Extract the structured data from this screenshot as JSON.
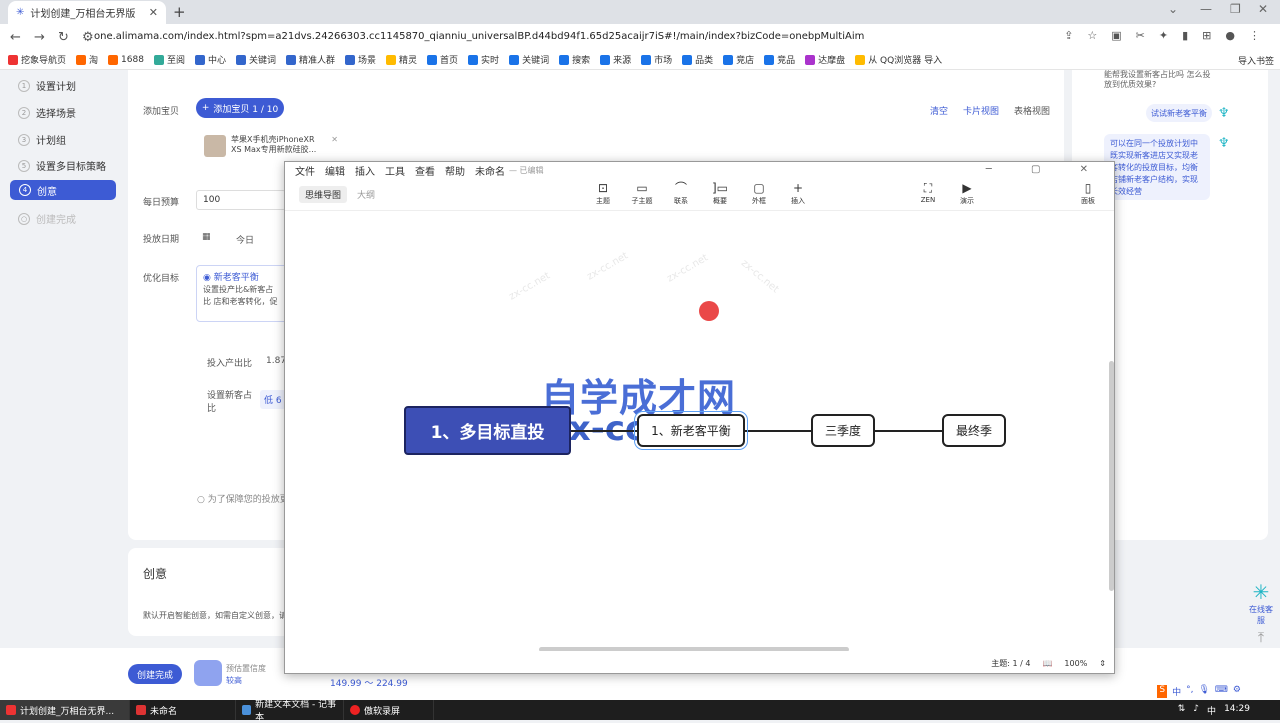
{
  "browser": {
    "tab_title": "计划创建_万相台无界版",
    "url": "one.alimama.com/index.html?spm=a21dvs.24266303.cc1145870_qianniu_universalBP.d44bd94f1.65d25acaijr7iS#!/main/index?bizCode=onebpMultiAim",
    "bookmarks": [
      "挖象导航页",
      "淘",
      "1688",
      "至阅",
      "中心",
      "关键词",
      "精准人群",
      "场景",
      "精灵",
      "首页",
      "实时",
      "关键词",
      "搜索",
      "来源",
      "市场",
      "品类",
      "竞店",
      "竞品",
      "达摩盘",
      "从 QQ浏览器 导入"
    ],
    "bookmarks_right": "导入书签"
  },
  "sidebar": {
    "steps": [
      {
        "n": "1",
        "label": "设置计划"
      },
      {
        "n": "2",
        "label": "选择场景"
      },
      {
        "n": "3",
        "label": "计划组"
      },
      {
        "n": "5",
        "label": "设置多目标策略"
      }
    ],
    "active": {
      "n": "4",
      "label": "创意"
    },
    "disabled": "创建完成"
  },
  "form": {
    "add_label": "添加宝贝",
    "add_btn": "添加宝贝 1 / 10",
    "clear": "清空",
    "card_view": "卡片视图",
    "table_view": "表格视图",
    "product": "苹果X手机壳iPhoneXR XS Max专用新款硅胶...",
    "budget_label": "每日预算",
    "budget": "100",
    "date_label": "投放日期",
    "date_today": "今日",
    "opt_label": "优化目标",
    "opt_title": "新老客平衡",
    "opt_desc": "设置投产比&新客占比 店和老客转化，促",
    "roi_label": "投入产出比",
    "roi_value": "1.87",
    "ratio_label": "设置新客占比",
    "ratio_value": "低 6",
    "guarantee": "为了保障您的投放更"
  },
  "creative": {
    "title": "创意",
    "desc": "默认开启智能创意，如需自定义创意，请"
  },
  "right": {
    "q1": "能帮我设置新客占比吗 怎么投放到优质效果?",
    "try_btn": "试试新老客平衡",
    "answer": "可以在同一个投放计划中既实现新客进店又实现老客转化的投放目标，均衡店铺新老客户结构，实现长效经营"
  },
  "bottom": {
    "done": "创建完成",
    "est_label": "预估置信度",
    "est_value": "较高",
    "price": "149.99 ～ 224.99"
  },
  "help": {
    "label": "在线客服"
  },
  "mindmap": {
    "menu": [
      "文件",
      "编辑",
      "插入",
      "工具",
      "查看",
      "帮助"
    ],
    "doc_name": "未命名",
    "saved": "— 已编辑",
    "views": {
      "active": "思维导图",
      "other": "大纲"
    },
    "tools": [
      {
        "icon": "⊡",
        "label": "主题"
      },
      {
        "icon": "▭",
        "label": "子主题"
      },
      {
        "icon": "⌒",
        "label": "联系"
      },
      {
        "icon": "]▭",
        "label": "概要"
      },
      {
        "icon": "▢",
        "label": "外框"
      },
      {
        "icon": "+",
        "label": "插入"
      }
    ],
    "tools_right": [
      {
        "icon": "⛶",
        "label": "ZEN"
      },
      {
        "icon": "▶",
        "label": "演示"
      },
      {
        "icon": "▯",
        "label": "面板"
      }
    ],
    "watermark_cn": "自学成才网",
    "watermark_en": "zx-cc.net",
    "nodes": {
      "root": "1、多目标直投",
      "n1": "1、新老客平衡",
      "n2": "三季度",
      "n3": "最终季"
    },
    "status": {
      "topics": "主题: 1 / 4",
      "zoom": "100%"
    }
  },
  "taskbar": {
    "items": [
      "计划创建_万相台无界...",
      "未命名",
      "新建文本文档 - 记事本",
      "傲软录屏"
    ],
    "clock": "14:29",
    "ime": "中"
  }
}
